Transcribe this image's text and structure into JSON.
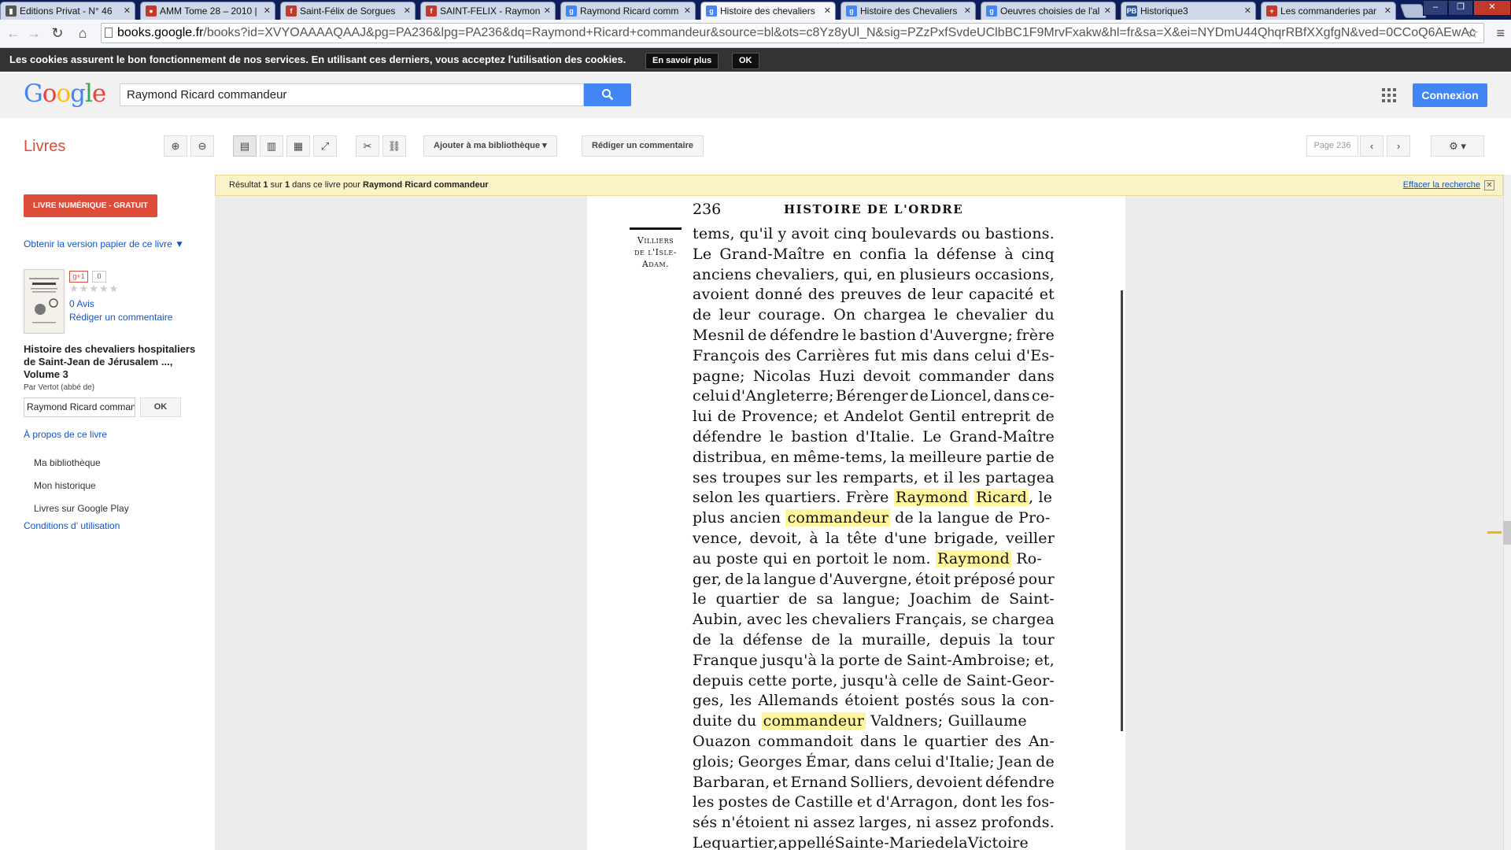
{
  "browser": {
    "tabs": [
      {
        "label": "Editions Privat - N° 46",
        "favicon": "privat-icon",
        "color": "#555555",
        "glyph": "▮"
      },
      {
        "label": "AMM Tome 28 – 2010 |",
        "favicon": "amm-icon",
        "color": "#c0392b",
        "glyph": "●"
      },
      {
        "label": "Saint-Félix de Sorgues",
        "favicon": "free-icon",
        "color": "#c0392b",
        "glyph": "f"
      },
      {
        "label": "SAINT-FELIX - Raymon",
        "favicon": "free-icon",
        "color": "#c0392b",
        "glyph": "f"
      },
      {
        "label": "Raymond Ricard comm",
        "favicon": "google-icon",
        "color": "#4285f4",
        "glyph": "g"
      },
      {
        "label": "Histoire des chevaliers",
        "favicon": "google-icon",
        "color": "#4285f4",
        "glyph": "g"
      },
      {
        "label": "Histoire des Chevaliers",
        "favicon": "google-icon",
        "color": "#4285f4",
        "glyph": "g"
      },
      {
        "label": "Oeuvres choisies de l'al",
        "favicon": "google-icon",
        "color": "#4285f4",
        "glyph": "g"
      },
      {
        "label": "Historique3",
        "favicon": "pb-icon",
        "color": "#2c5aa0",
        "glyph": "PB"
      },
      {
        "label": "Les commanderies par",
        "favicon": "cross-icon",
        "color": "#c0392b",
        "glyph": "+"
      }
    ],
    "url_host": "books.google.fr",
    "url_rest": "/books?id=XVYOAAAAQAAJ&pg=PA236&lpg=PA236&dq=Raymond+Ricard+commandeur&source=bl&ots=c8Yz8yUl_N&sig=PZzPxfSvdeUClbBC1F9MrvFxakw&hl=fr&sa=X&ei=NYDmU44QhqrRBfXXgfgN&ved=0CCoQ6AEwAc"
  },
  "cookie_bar": {
    "text": "Les cookies assurent le bon fonctionnement de nos services. En utilisant ces derniers, vous acceptez l'utilisation des cookies.",
    "learn_more": "En savoir plus",
    "ok": "OK"
  },
  "header": {
    "logo": "Google",
    "search_value": "Raymond Ricard commandeur",
    "signin": "Connexion"
  },
  "books_toolbar": {
    "section": "Livres",
    "add_library": "Ajouter à ma bibliothèque",
    "write_review": "Rédiger un commentaire",
    "page_box": "Page 236"
  },
  "sidebar": {
    "ebook_button": "LIVRE NUMÉRIQUE - GRATUIT",
    "paper_version": "Obtenir la version papier de ce livre ▼",
    "gplus": "g+1",
    "gplus_count": "0",
    "reviews": "0 Avis",
    "write_review": "Rédiger un commentaire",
    "book_title": "Histoire des chevaliers hospitaliers de Saint-Jean de Jérusalem ..., Volume 3",
    "author": "Par Vertot (abbé de)",
    "search_value": "Raymond Ricard commandeur",
    "search_ok": "OK",
    "about": "À propos de ce livre",
    "links": [
      "Ma bibliothèque",
      "Mon historique",
      "Livres sur Google Play"
    ],
    "terms": "Conditions d' utilisation"
  },
  "result_bar": {
    "prefix": "Résultat",
    "current": "1",
    "sep": "sur",
    "total": "1",
    "middle": "dans ce livre pour",
    "query": "Raymond Ricard commandeur",
    "clear": "Effacer la recherche"
  },
  "book_page": {
    "page_number": "236",
    "running_title": "HISTOIRE DE L'ORDRE",
    "marginal_note": [
      "Villiers",
      "de l'Isle-",
      "Adam."
    ],
    "lines": [
      [
        {
          "t": "tems, qu'il y avoit cinq boulevards ou bastions."
        }
      ],
      [
        {
          "t": "Le Grand-Maître en confia la défense à cinq"
        }
      ],
      [
        {
          "t": "anciens chevaliers, qui, en plusieurs occasions,"
        }
      ],
      [
        {
          "t": "avoient donné des preuves de leur capacité et"
        }
      ],
      [
        {
          "t": "de leur courage. On chargea le chevalier du"
        }
      ],
      [
        {
          "t": "Mesnil de défendre le bastion d'Auvergne; frère"
        }
      ],
      [
        {
          "t": "François des Carrières fut mis dans celui d'Es-"
        }
      ],
      [
        {
          "t": "pagne; Nicolas Huzi devoit commander dans"
        }
      ],
      [
        {
          "t": "celui d'Angleterre; Bérenger de Lioncel, dans ce-"
        }
      ],
      [
        {
          "t": "lui de Provence; et Andelot Gentil entreprit de"
        }
      ],
      [
        {
          "t": "défendre le bastion d'Italie. Le Grand-Maître"
        }
      ],
      [
        {
          "t": "distribua, en même-tems, la meilleure partie de"
        }
      ],
      [
        {
          "t": "ses troupes sur les remparts, et il les partagea"
        }
      ],
      [
        {
          "t": "selon les quartiers. Frère "
        },
        {
          "t": "Raymond",
          "h": true
        },
        {
          "t": " "
        },
        {
          "t": "Ricard",
          "h": true
        },
        {
          "t": ", le"
        }
      ],
      [
        {
          "t": "plus ancien "
        },
        {
          "t": "commandeur",
          "h": true
        },
        {
          "t": " de la langue de Pro-"
        }
      ],
      [
        {
          "t": "vence, devoit, à la tête d'une brigade, veiller"
        }
      ],
      [
        {
          "t": "au poste qui en portoit le nom. "
        },
        {
          "t": "Raymond",
          "h": true
        },
        {
          "t": " Ro-"
        }
      ],
      [
        {
          "t": "ger, de la langue d'Auvergne, étoit préposé pour"
        }
      ],
      [
        {
          "t": "le quartier de sa langue; Joachim de Saint-"
        }
      ],
      [
        {
          "t": "Aubin, avec les chevaliers Français, se chargea"
        }
      ],
      [
        {
          "t": "de la défense de la muraille, depuis la tour"
        }
      ],
      [
        {
          "t": "Franque jusqu'à la porte de Saint-Ambroise; et,"
        }
      ],
      [
        {
          "t": "depuis cette porte, jusqu'à celle de Saint-Geor-"
        }
      ],
      [
        {
          "t": "ges, les Allemands étoient postés sous la con-"
        }
      ],
      [
        {
          "t": "duite du "
        },
        {
          "t": "commandeur",
          "h": true
        },
        {
          "t": " Valdners; Guillaume"
        }
      ],
      [
        {
          "t": "Ouazon commandoit dans le quartier des An-"
        }
      ],
      [
        {
          "t": "glois; Georges Émar, dans celui d'Italie; Jean de"
        }
      ],
      [
        {
          "t": "Barbaran, et Ernand Solliers, devoient défendre"
        }
      ],
      [
        {
          "t": "les postes de Castille et d'Arragon, dont les fos-"
        }
      ],
      [
        {
          "t": "sés n'étoient ni assez larges, ni assez profonds."
        }
      ],
      [
        {
          "t": "Le quartier, appellé Sainte-Marie de la Victoire"
        }
      ]
    ]
  },
  "colors": {
    "highlight": "#fff59d",
    "brand_red": "#dd4b39",
    "brand_blue": "#4285f4",
    "link_blue": "#1155cc"
  }
}
